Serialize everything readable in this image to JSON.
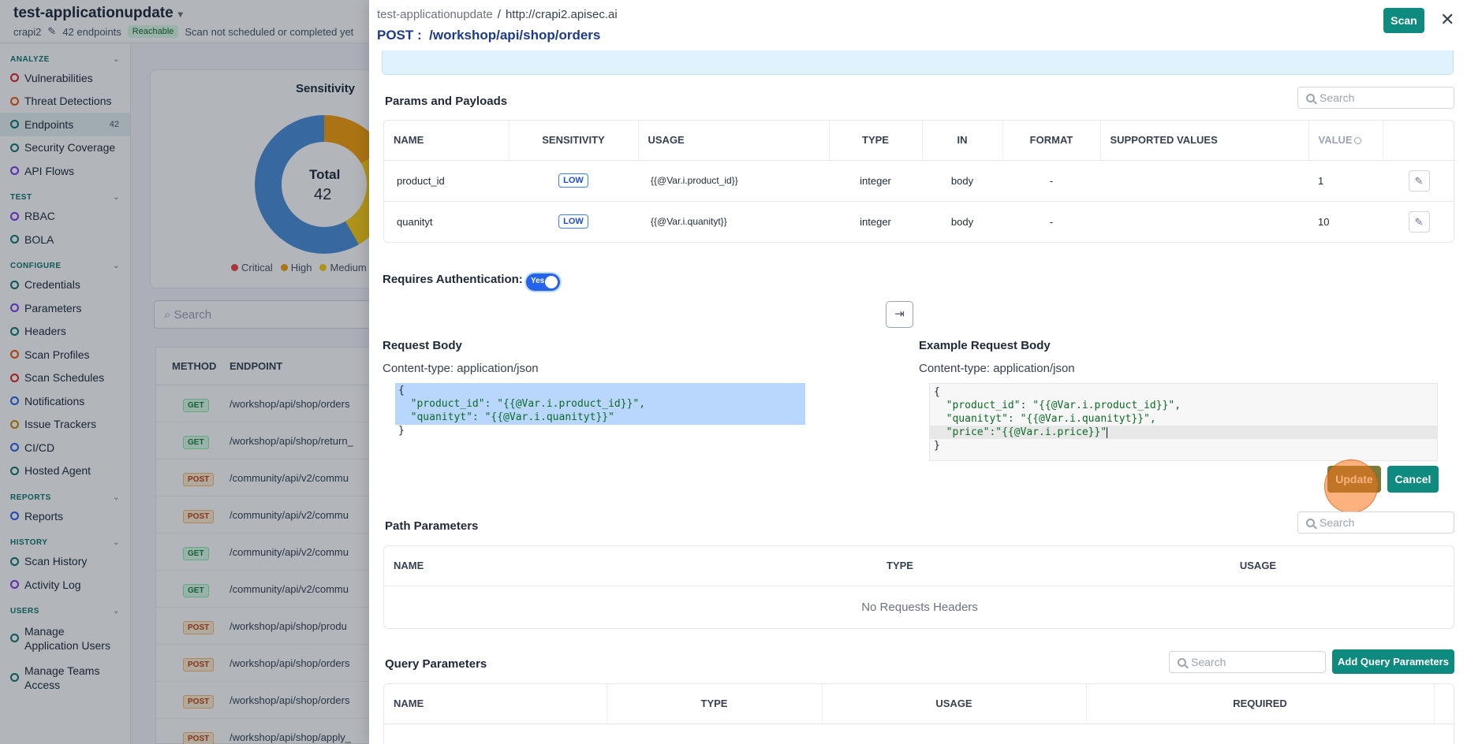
{
  "app": {
    "title": "test-applicationupdate",
    "project": "crapi2",
    "endpoints_count": "42 endpoints",
    "reachable": "Reachable",
    "scan_status": "Scan not scheduled or completed yet"
  },
  "sidebar": {
    "sections": [
      {
        "label": "ANALYZE",
        "items": [
          {
            "label": "Vulnerabilities",
            "icon": "shield-icon"
          },
          {
            "label": "Threat Detections",
            "icon": "target-icon"
          },
          {
            "label": "Endpoints",
            "icon": "endpoints-icon",
            "count": "42",
            "active": true
          },
          {
            "label": "Security Coverage",
            "icon": "coverage-icon"
          },
          {
            "label": "API Flows",
            "icon": "flow-icon"
          }
        ]
      },
      {
        "label": "TEST",
        "items": [
          {
            "label": "RBAC",
            "icon": "users-icon"
          },
          {
            "label": "BOLA",
            "icon": "shield-icon"
          }
        ]
      },
      {
        "label": "CONFIGURE",
        "items": [
          {
            "label": "Credentials",
            "icon": "key-icon"
          },
          {
            "label": "Parameters",
            "icon": "braces-icon"
          },
          {
            "label": "Headers",
            "icon": "headers-icon"
          },
          {
            "label": "Scan Profiles",
            "icon": "profile-icon"
          },
          {
            "label": "Scan Schedules",
            "icon": "calendar-icon"
          },
          {
            "label": "Notifications",
            "icon": "bell-icon"
          },
          {
            "label": "Issue Trackers",
            "icon": "tracker-icon"
          },
          {
            "label": "CI/CD",
            "icon": "cicd-icon"
          },
          {
            "label": "Hosted Agent",
            "icon": "agent-icon"
          }
        ]
      },
      {
        "label": "REPORTS",
        "items": [
          {
            "label": "Reports",
            "icon": "report-icon"
          }
        ]
      },
      {
        "label": "HISTORY",
        "items": [
          {
            "label": "Scan History",
            "icon": "history-icon"
          },
          {
            "label": "Activity Log",
            "icon": "log-icon"
          }
        ]
      },
      {
        "label": "USERS",
        "items": [
          {
            "label": "Manage Application Users",
            "icon": "user-icon"
          },
          {
            "label": "Manage Teams Access",
            "icon": "team-icon"
          }
        ]
      }
    ]
  },
  "background": {
    "sensitivity_title": "Sensitivity",
    "total_label": "Total",
    "total_value": "42",
    "legend": [
      "Critical",
      "High",
      "Medium"
    ],
    "search_placeholder": "Search",
    "table_headers": [
      "METHOD",
      "ENDPOINT"
    ],
    "rows": [
      {
        "method": "GET",
        "endpoint": "/workshop/api/shop/orders"
      },
      {
        "method": "GET",
        "endpoint": "/workshop/api/shop/return_"
      },
      {
        "method": "POST",
        "endpoint": "/community/api/v2/commu"
      },
      {
        "method": "POST",
        "endpoint": "/community/api/v2/commu"
      },
      {
        "method": "GET",
        "endpoint": "/community/api/v2/commu"
      },
      {
        "method": "GET",
        "endpoint": "/community/api/v2/commu"
      },
      {
        "method": "POST",
        "endpoint": "/workshop/api/shop/produ"
      },
      {
        "method": "POST",
        "endpoint": "/workshop/api/shop/orders"
      },
      {
        "method": "POST",
        "endpoint": "/workshop/api/shop/orders"
      },
      {
        "method": "POST",
        "endpoint": "/workshop/api/shop/apply_"
      }
    ]
  },
  "drawer": {
    "breadcrumb_app": "test-applicationupdate",
    "breadcrumb_sep": "/",
    "breadcrumb_host": "http://crapi2.apisec.ai",
    "method": "POST :",
    "path": "/workshop/api/shop/orders",
    "scan_label": "Scan",
    "close_glyph": "✕",
    "params": {
      "title": "Params and Payloads",
      "search_placeholder": "Search",
      "headers": [
        "NAME",
        "SENSITIVITY",
        "USAGE",
        "TYPE",
        "IN",
        "FORMAT",
        "SUPPORTED VALUES",
        "VALUE",
        ""
      ],
      "rows": [
        {
          "name": "product_id",
          "sensitivity": "LOW",
          "usage": "{{@Var.i.product_id}}",
          "type": "integer",
          "in": "body",
          "format": "-",
          "supported": "",
          "value": "1"
        },
        {
          "name": "quanityt",
          "sensitivity": "LOW",
          "usage": "{{@Var.i.quanityt}}",
          "type": "integer",
          "in": "body",
          "format": "-",
          "supported": "",
          "value": "10"
        }
      ]
    },
    "auth": {
      "label": "Requires Authentication:",
      "toggle": "Yes"
    },
    "request_body": {
      "title": "Request Body",
      "content_type": "Content-type: application/json",
      "lines": [
        "{",
        "  \"product_id\": \"{{@Var.i.product_id}}\",",
        "  \"quanityt\": \"{{@Var.i.quanityt}}\"",
        "}"
      ]
    },
    "example_body": {
      "title": "Example Request Body",
      "content_type": "Content-type: application/json",
      "lines": [
        "{",
        "  \"product_id\": \"{{@Var.i.product_id}}\",",
        "  \"quanityt\": \"{{@Var.i.quanityt}}\",",
        "  \"price\":\"{{@Var.i.price}}\"",
        "}"
      ]
    },
    "update_label": "Update",
    "cancel_label": "Cancel",
    "path_params": {
      "title": "Path Parameters",
      "search_placeholder": "Search",
      "headers": [
        "NAME",
        "TYPE",
        "USAGE"
      ],
      "empty": "No Requests Headers"
    },
    "query_params": {
      "title": "Query Parameters",
      "search_placeholder": "Search",
      "add_label": "Add Query Parameters",
      "headers": [
        "NAME",
        "TYPE",
        "USAGE",
        "REQUIRED"
      ]
    }
  },
  "colors": {
    "accent": "#0f8a7e",
    "link": "#1e3a8a",
    "toggle": "#2563eb",
    "selection": "#b9d6fd"
  }
}
